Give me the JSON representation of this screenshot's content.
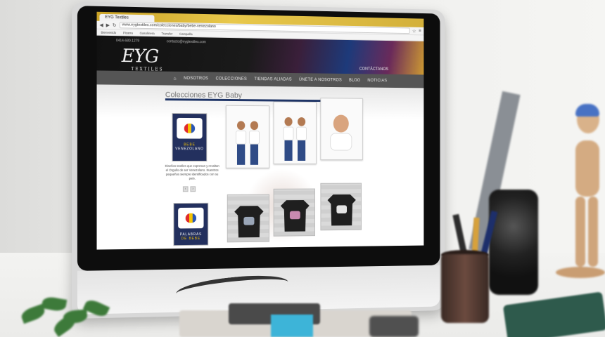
{
  "browser": {
    "tab_title": "EYG Textiles",
    "url": "www.eygtextiles.com/colecciones/baby/bebe-venezolano",
    "bookmarks": [
      "Bienvenido",
      "Pizarra",
      "Gasolinera",
      "Transfer",
      "Campaña"
    ]
  },
  "site": {
    "contact_phone": "0414-680-1279",
    "contact_email": "contacto@eygtextiles.com",
    "logo_mark": "EYG",
    "logo_sub": "TEXTILES",
    "nav": [
      "NOSOTROS",
      "COLECCIONES",
      "TIENDAS ALIADAS",
      "ÚNETE A NOSOTROS",
      "BLOG",
      "NOTICIAS"
    ],
    "nav_right": "CONTÁCTANOS",
    "page_title": "Colecciones EYG Baby",
    "promo_top": {
      "line1": "BEBE",
      "line2": "VENEZOLANO"
    },
    "promo_bottom": {
      "line1": "PALABRAS",
      "line2": "DE BEBE"
    },
    "promo_description": "Diseños textiles que expresan y resaltan el Orgullo de ser Venezolano. Nuestros pequeños siempre identificados con su país.",
    "arrows": [
      "‹",
      "›"
    ]
  },
  "icons": {
    "home": "home-icon",
    "apple": "apple-logo"
  },
  "colors": {
    "nav_bg": "#555555",
    "title_rule": "#1e3466",
    "promo_bg": "#23305e"
  }
}
